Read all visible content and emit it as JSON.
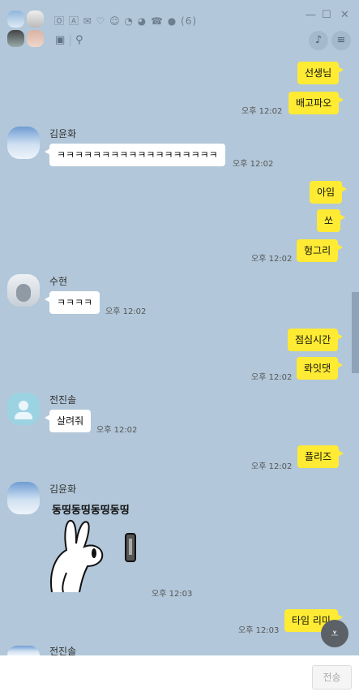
{
  "header": {
    "title": "🄾 🄰 ✉ ♡ ☺ ◔ ◕ ☎ ● (6)",
    "participant_count": "(6)",
    "icons": [
      "drawer-icon",
      "search-icon",
      "bell-icon",
      "menu-icon"
    ],
    "window_controls": [
      "minimize-icon",
      "maximize-icon",
      "close-icon"
    ]
  },
  "messages": {
    "m1": "선생님",
    "m2": "배고파오",
    "t2": "오후 12:02",
    "kim_name": "김윤화",
    "m3": "ㅋㅋㅋㅋㅋㅋㅋㅋㅋㅋㅋㅋㅋㅋㅋㅋㅋㅋ",
    "t3": "오후 12:02",
    "m4": "아임",
    "m5": "쏘",
    "m6": "헝그리",
    "t6": "오후 12:02",
    "su_name": "수현",
    "m7": "ㅋㅋㅋㅋ",
    "t7": "오후 12:02",
    "m8": "점심시간",
    "m9": "롸잇댓",
    "t9": "오후 12:02",
    "jeon_name": "전진솔",
    "m10": "살려줘",
    "t10": "오후 12:02",
    "m11": "플리즈",
    "t11": "오후 12:02",
    "kim2_name": "김윤화",
    "m12": "동띵동띵동띵동띵",
    "t12": "오후 12:03",
    "m13": "타임 리미",
    "t13": "오후 12:03",
    "jeon2_name": "전진솔"
  },
  "input": {
    "send_label": "전송"
  },
  "colors": {
    "background": "#b2c7d9",
    "my_bubble": "#ffeb33",
    "their_bubble": "#ffffff"
  }
}
